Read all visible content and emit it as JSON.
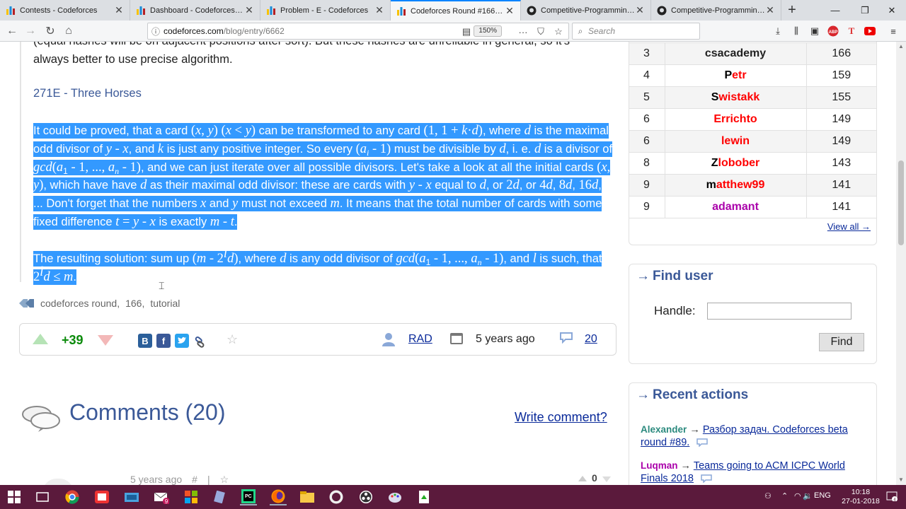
{
  "browser": {
    "tabs": [
      {
        "title": "Contests - Codeforces",
        "active": false
      },
      {
        "title": "Dashboard - Codeforces Round",
        "active": false
      },
      {
        "title": "Problem - E - Codeforces",
        "active": false
      },
      {
        "title": "Codeforces Round #166 Tutori",
        "active": true
      },
      {
        "title": "Competitive-Programming/Cf",
        "active": false
      },
      {
        "title": "Competitive-Programming/Ea",
        "active": false
      }
    ],
    "url_host": "codeforces.com",
    "url_path": "/blog/entry/6662",
    "zoom": "150%",
    "search_placeholder": "Search"
  },
  "article": {
    "prev_line_1": "(equal hashes will be on adjacent positions after sort). But these hashes are unreliable in general, so it's",
    "prev_line_2": "always better to use precise algorithm.",
    "section_title": "271E - Three Horses",
    "tags": [
      "codeforces round",
      "166",
      "tutorial"
    ],
    "votes": "+39",
    "author": "RAD",
    "posted": "5 years ago",
    "comment_count": "20"
  },
  "comments": {
    "title": "Comments (20)",
    "write_label": "Write comment?",
    "first_meta_time": "5 years ago",
    "first_meta_hash": "#",
    "first_meta_sep": "|",
    "first_score": "0"
  },
  "rating": {
    "rows": [
      {
        "rank": "3",
        "handle": "csacademy",
        "value": "166",
        "first": "",
        "rest": "csacademy",
        "color": "#222222",
        "first_color": "#222222"
      },
      {
        "rank": "4",
        "handle": "Petr",
        "value": "159",
        "first": "P",
        "rest": "etr",
        "color": "#ff0000",
        "first_color": "#000000"
      },
      {
        "rank": "5",
        "handle": "Swistakk",
        "value": "155",
        "first": "S",
        "rest": "wistakk",
        "color": "#ff0000",
        "first_color": "#000000"
      },
      {
        "rank": "6",
        "handle": "Errichto",
        "value": "149",
        "first": "",
        "rest": "Errichto",
        "color": "#ff0000",
        "first_color": "#ff0000"
      },
      {
        "rank": "6",
        "handle": "lewin",
        "value": "149",
        "first": "",
        "rest": "lewin",
        "color": "#ff0000",
        "first_color": "#ff0000"
      },
      {
        "rank": "8",
        "handle": "Zlobober",
        "value": "143",
        "first": "Z",
        "rest": "lobober",
        "color": "#ff0000",
        "first_color": "#000000"
      },
      {
        "rank": "9",
        "handle": "matthew99",
        "value": "141",
        "first": "m",
        "rest": "atthew99",
        "color": "#ff0000",
        "first_color": "#000000"
      },
      {
        "rank": "9",
        "handle": "adamant",
        "value": "141",
        "first": "",
        "rest": "adamant",
        "color": "#aa00aa",
        "first_color": "#aa00aa"
      }
    ],
    "view_all": "View all →"
  },
  "find_user": {
    "title": "Find user",
    "arrow": "→",
    "handle_label": "Handle:",
    "button": "Find"
  },
  "recent_actions": {
    "title": "Recent actions",
    "arrow": "→",
    "items": [
      {
        "user": "Alexander",
        "link": "Разбор задач. Codeforces beta round #89."
      },
      {
        "user": "Luqman",
        "link": "Teams going to ACM ICPC World Finals 2018"
      }
    ]
  },
  "taskbar": {
    "lang": "ENG",
    "time": "10:18",
    "date": "27-01-2018",
    "mail_badge": "9",
    "notif_badge": "4"
  },
  "colors": {
    "selection": "#3399ff",
    "link": "#0a2a9a",
    "heading": "#3b5998",
    "taskbar": "#5b1a3c"
  }
}
